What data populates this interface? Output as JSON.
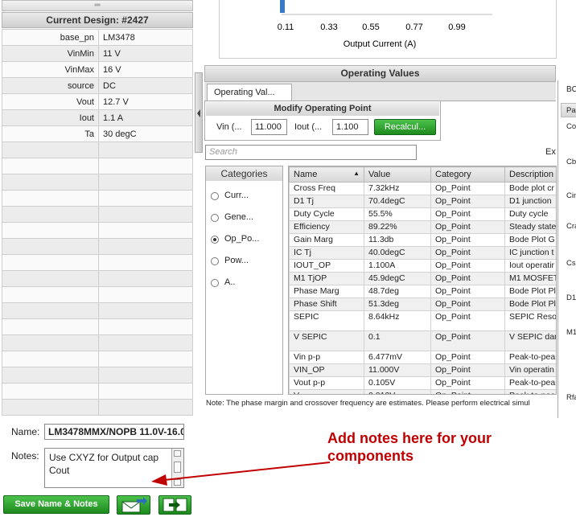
{
  "design_panel": {
    "title": "Current Design: #2427",
    "properties": [
      {
        "key": "base_pn",
        "value": "LM3478"
      },
      {
        "key": "VinMin",
        "value": "11 V"
      },
      {
        "key": "VinMax",
        "value": "16 V"
      },
      {
        "key": "source",
        "value": "DC"
      },
      {
        "key": "Vout",
        "value": "12.7 V"
      },
      {
        "key": "Iout",
        "value": "1.1 A"
      },
      {
        "key": "Ta",
        "value": "30 degC"
      }
    ],
    "name_label": "Name:",
    "name_value": "LM3478MMX/NOPB 11.0V-16.0",
    "notes_label": "Notes:",
    "notes_value": "Use CXYZ for Output cap Cout",
    "save_label": "Save Name & Notes"
  },
  "chart": {
    "x_ticks": [
      "0.11",
      "0.33",
      "0.55",
      "0.77",
      "0.99"
    ],
    "x_label": "Output Current (A)"
  },
  "operating_values": {
    "title": "Operating Values",
    "tab_label": "Operating Val...",
    "modify_title": "Modify Operating Point",
    "vin_label": "Vin (...",
    "vin_value": "11.000",
    "iout_label": "Iout (...",
    "iout_value": "1.100",
    "recalc_label": "Recalcul...",
    "search_placeholder": "Search",
    "ex_label": "Ex",
    "categories_title": "Categories",
    "categories": [
      {
        "label": "Curr...",
        "selected": false
      },
      {
        "label": "Gene...",
        "selected": false
      },
      {
        "label": "Op_Po...",
        "selected": true
      },
      {
        "label": "Pow...",
        "selected": false
      },
      {
        "label": "A..",
        "selected": false
      }
    ],
    "columns": [
      "Name",
      "Value",
      "Category",
      "Description"
    ],
    "rows": [
      {
        "name": "Cross Freq",
        "value": "7.32kHz",
        "category": "Op_Point",
        "description": "Bode plot cr"
      },
      {
        "name": "D1 Tj",
        "value": "70.4degC",
        "category": "Op_Point",
        "description": "D1 junction"
      },
      {
        "name": "Duty Cycle",
        "value": "55.5%",
        "category": "Op_Point",
        "description": "Duty cycle"
      },
      {
        "name": "Efficiency",
        "value": "89.22%",
        "category": "Op_Point",
        "description": "Steady state"
      },
      {
        "name": "Gain Marg",
        "value": "11.3db",
        "category": "Op_Point",
        "description": "Bode Plot G"
      },
      {
        "name": "IC Tj",
        "value": "40.0degC",
        "category": "Op_Point",
        "description": "IC junction t"
      },
      {
        "name": "IOUT_OP",
        "value": "1.100A",
        "category": "Op_Point",
        "description": "Iout operatir"
      },
      {
        "name": "M1 TjOP",
        "value": "45.9degC",
        "category": "Op_Point",
        "description": "M1 MOSFET"
      },
      {
        "name": "Phase Marg",
        "value": "48.7deg",
        "category": "Op_Point",
        "description": "Bode Plot Pl"
      },
      {
        "name": "Phase Shift",
        "value": "51.3deg",
        "category": "Op_Point",
        "description": "Bode Plot Pl"
      },
      {
        "name": "SEPIC",
        "value": "8.64kHz",
        "category": "Op_Point",
        "description": "SEPIC Reso"
      },
      {
        "name": "V SEPIC",
        "value": "0.1",
        "category": "Op_Point",
        "description": "V SEPIC dar"
      },
      {
        "name": "Vin p-p",
        "value": "6.477mV",
        "category": "Op_Point",
        "description": "Peak-to-pea"
      },
      {
        "name": "VIN_OP",
        "value": "11.000V",
        "category": "Op_Point",
        "description": "Vin operatin"
      },
      {
        "name": "Vout p-p",
        "value": "0.105V",
        "category": "Op_Point",
        "description": "Peak-to-pea"
      },
      {
        "name": "V...",
        "value": "0.012V",
        "category": "Op_Point",
        "description": "Peak-to-pea"
      }
    ],
    "note": "Note: The phase margin and crossover frequency are estimates.  Please perform electrical simul"
  },
  "right_panel": {
    "tab": "BC",
    "header": "Pa",
    "items": [
      "Co",
      "Cb",
      "Cin",
      "Cra",
      "Cs",
      "D1",
      "M1",
      "Rfa"
    ]
  },
  "annotation": {
    "line1": "Add notes here for your",
    "line2": "components"
  },
  "colors": {
    "annotation": "#c00000",
    "button_green": "#1d8a1d"
  }
}
